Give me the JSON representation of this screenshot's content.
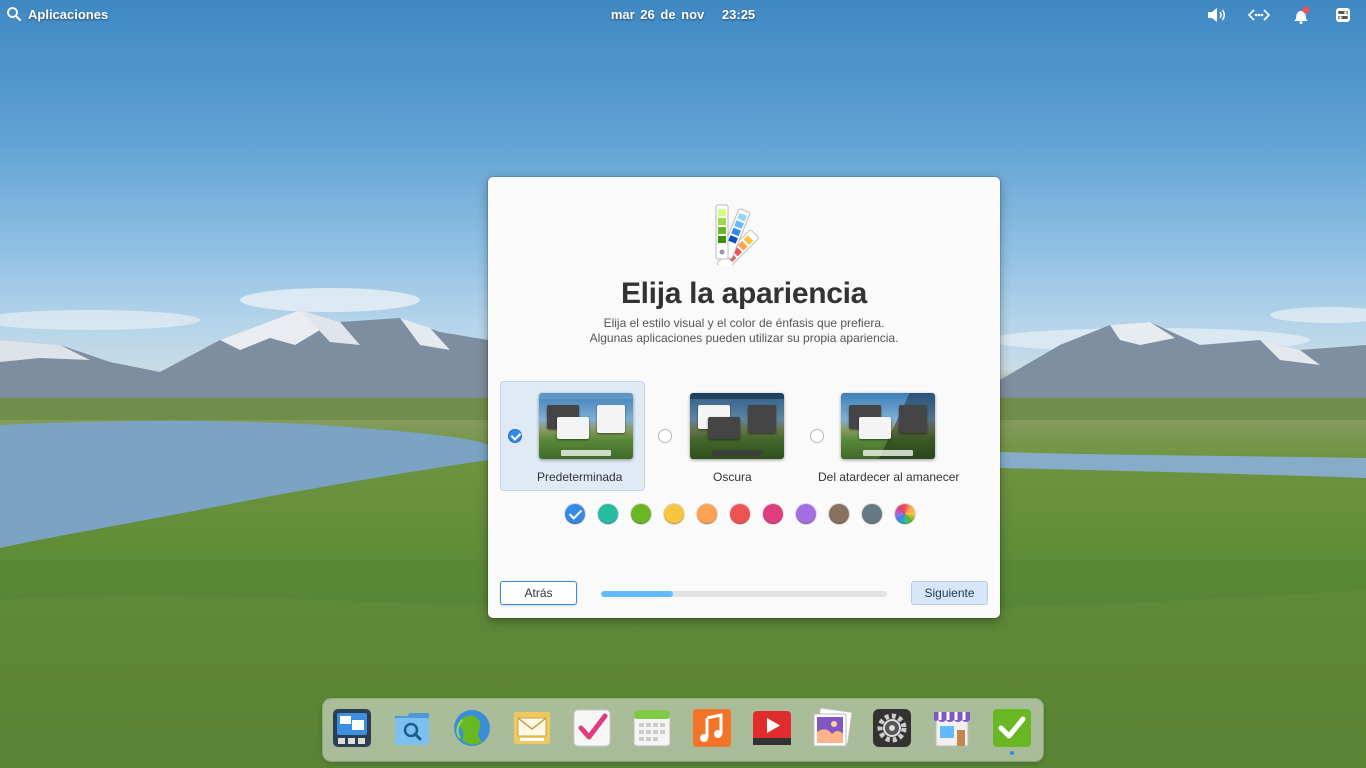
{
  "panel": {
    "apps_label": "Aplicaciones",
    "date": "mar 26 de nov",
    "time": "23:25",
    "indicators": [
      "volume-icon",
      "network-icon",
      "notifications-icon",
      "session-icon"
    ]
  },
  "dialog": {
    "icon": "color-palette-icon",
    "title": "Elija la apariencia",
    "subtitle_line1": "Elija el estilo visual y el color de énfasis que prefiera.",
    "subtitle_line2": "Algunas aplicaciones pueden utilizar su propia apariencia.",
    "styles": [
      {
        "label": "Predeterminada",
        "selected": true
      },
      {
        "label": "Oscura",
        "selected": false
      },
      {
        "label": "Del atardecer al amanecer",
        "selected": false
      }
    ],
    "accent_colors": [
      "#3689e6",
      "#28bca3",
      "#68b723",
      "#f9c440",
      "#ffa154",
      "#ed5353",
      "#de3e80",
      "#a56de2",
      "#8a715e",
      "#667885",
      "multicolor"
    ],
    "accent_selected_index": 0,
    "back_label": "Atrás",
    "next_label": "Siguiente",
    "progress_percent": 25
  },
  "dock": {
    "apps": [
      "multitasking-view-icon",
      "files-icon",
      "web-browser-icon",
      "mail-icon",
      "tasks-icon",
      "calendar-icon",
      "music-icon",
      "videos-icon",
      "photos-icon",
      "system-settings-icon",
      "appcenter-icon",
      "onboarding-icon"
    ],
    "running_index": 11
  }
}
